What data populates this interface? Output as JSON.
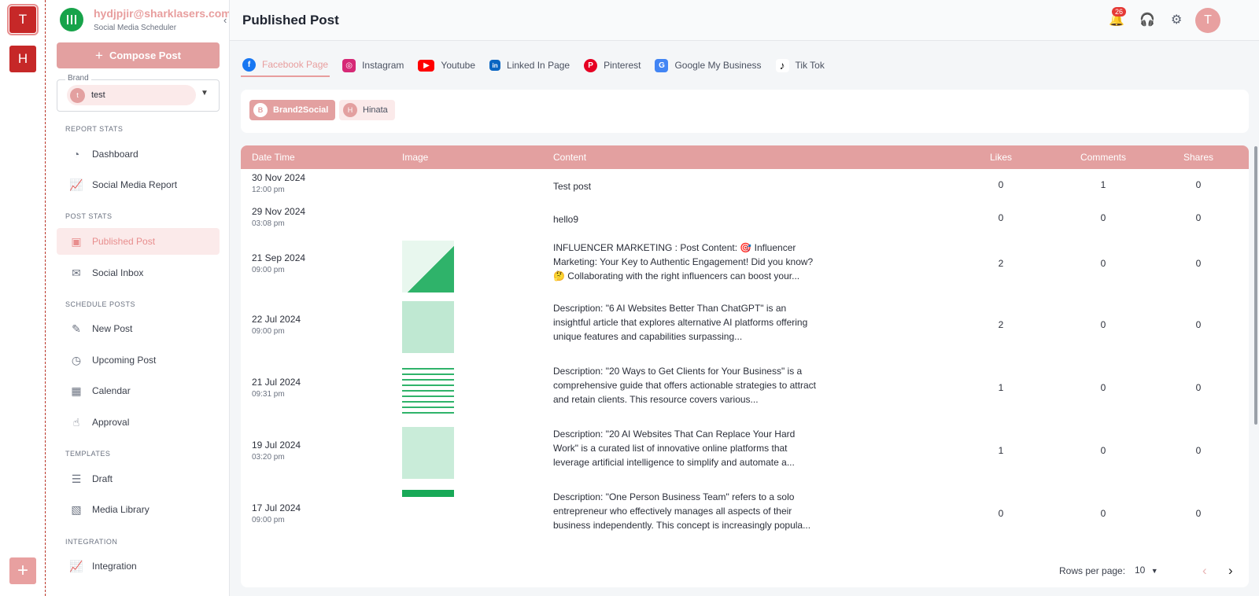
{
  "workspaces": [
    "T",
    "H"
  ],
  "account": {
    "email": "hydjpjir@sharklasers.com",
    "subtitle": "Social Media Scheduler"
  },
  "sidebar": {
    "compose_label": "Compose Post",
    "brand_label": "Brand",
    "brand_value": "test",
    "brand_initial": "t",
    "sections": {
      "report": "REPORT STATS",
      "post": "POST STATS",
      "schedule": "SCHEDULE POSTS",
      "templates": "TEMPLATES",
      "integration": "INTEGRATION"
    },
    "items": {
      "dashboard": "Dashboard",
      "social_report": "Social Media Report",
      "published": "Published Post",
      "inbox": "Social Inbox",
      "new_post": "New Post",
      "upcoming": "Upcoming Post",
      "calendar": "Calendar",
      "approval": "Approval",
      "draft": "Draft",
      "media": "Media Library",
      "integration": "Integration"
    }
  },
  "header": {
    "title": "Published Post",
    "notification_count": "26",
    "avatar_initial": "T"
  },
  "tabs": [
    {
      "label": "Facebook Page",
      "icon": "facebook-icon",
      "color": "#1877f2",
      "glyph": "f"
    },
    {
      "label": "Instagram",
      "icon": "instagram-icon",
      "color": "#d62976",
      "glyph": "◎"
    },
    {
      "label": "Youtube",
      "icon": "youtube-icon",
      "color": "#ff0000",
      "glyph": "▶"
    },
    {
      "label": "Linked In Page",
      "icon": "linkedin-icon",
      "color": "#0a66c2",
      "glyph": "in"
    },
    {
      "label": "Pinterest",
      "icon": "pinterest-icon",
      "color": "#e60023",
      "glyph": "P"
    },
    {
      "label": "Google My Business",
      "icon": "google-business-icon",
      "color": "#4285f4",
      "glyph": "G"
    },
    {
      "label": "Tik Tok",
      "icon": "tiktok-icon",
      "color": "#111111",
      "glyph": "♪"
    }
  ],
  "pages": [
    {
      "label": "Brand2Social",
      "initial": "B",
      "selected": true
    },
    {
      "label": "Hinata",
      "initial": "H",
      "selected": false
    }
  ],
  "table": {
    "columns": [
      "Date Time",
      "Image",
      "Content",
      "Likes",
      "Comments",
      "Shares"
    ],
    "rows": [
      {
        "date": "30 Nov 2024",
        "time": "12:00 pm",
        "image": false,
        "content": "Test post",
        "likes": "0",
        "comments": "1",
        "shares": "0"
      },
      {
        "date": "29 Nov 2024",
        "time": "03:08 pm",
        "image": false,
        "content": "hello9",
        "likes": "0",
        "comments": "0",
        "shares": "0"
      },
      {
        "date": "21 Sep 2024",
        "time": "09:00 pm",
        "image": true,
        "content": "INFLUENCER MARKETING : Post Content: 🎯 Influencer Marketing: Your Key to Authentic Engagement! Did you know? 🤔 Collaborating with the right influencers can boost your...",
        "likes": "2",
        "comments": "0",
        "shares": "0"
      },
      {
        "date": "22 Jul 2024",
        "time": "09:00 pm",
        "image": true,
        "content": "Description: \"6 AI Websites Better Than ChatGPT\" is an insightful article that explores alternative AI platforms offering unique features and capabilities surpassing...",
        "likes": "2",
        "comments": "0",
        "shares": "0"
      },
      {
        "date": "21 Jul 2024",
        "time": "09:31 pm",
        "image": true,
        "content": "Description: \"20 Ways to Get Clients for Your Business\" is a comprehensive guide that offers actionable strategies to attract and retain clients. This resource covers various...",
        "likes": "1",
        "comments": "0",
        "shares": "0"
      },
      {
        "date": "19 Jul 2024",
        "time": "03:20 pm",
        "image": true,
        "content": "Description: \"20 AI Websites That Can Replace Your Hard Work\" is a curated list of innovative online platforms that leverage artificial intelligence to simplify and automate a...",
        "likes": "1",
        "comments": "0",
        "shares": "0"
      },
      {
        "date": "17 Jul 2024",
        "time": "09:00 pm",
        "image": true,
        "content": "Description: \"One Person Business Team\" refers to a solo entrepreneur who effectively manages all aspects of their business independently. This concept is increasingly popula...",
        "likes": "0",
        "comments": "0",
        "shares": "0"
      }
    ]
  },
  "pagination": {
    "rows_label": "Rows per page:",
    "rows_value": "10"
  },
  "colors": {
    "accent": "#e3a0a0",
    "workspace": "#c62828"
  }
}
